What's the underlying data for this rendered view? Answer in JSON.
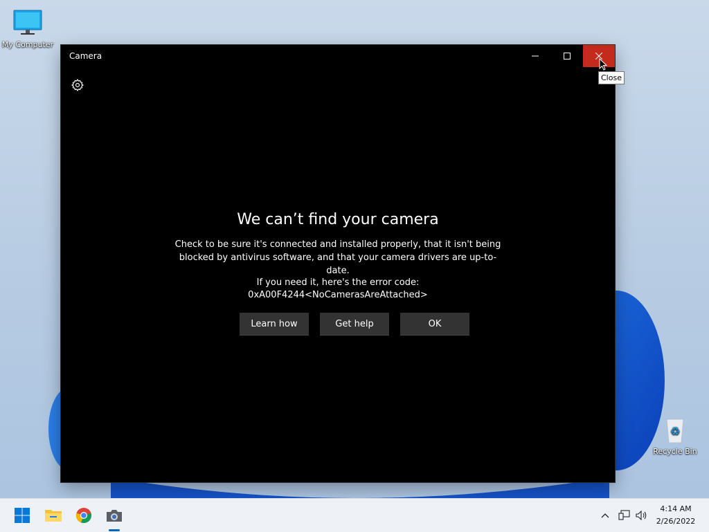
{
  "desktop": {
    "icons": [
      {
        "label": "My Computer",
        "icon": "monitor-icon"
      },
      {
        "label": "Recycle Bin",
        "icon": "recycle-bin-icon"
      }
    ]
  },
  "window": {
    "title": "Camera",
    "settings_icon": "gear-icon",
    "error": {
      "title": "We can’t find your camera",
      "description": "Check to be sure it's connected and installed properly, that it isn't being blocked by antivirus software, and that your camera drivers are up-to-date.",
      "code_label": "If you need it, here's the error code:",
      "code": "0xA00F4244<NoCamerasAreAttached>"
    },
    "buttons": {
      "learn_how": "Learn how",
      "get_help": "Get help",
      "ok": "OK"
    },
    "controls": [
      "minimize-icon",
      "maximize-icon",
      "close-icon"
    ]
  },
  "tooltip": {
    "text": "Close"
  },
  "taskbar": {
    "apps": [
      {
        "name": "Start",
        "icon": "windows-start-icon"
      },
      {
        "name": "File Explorer",
        "icon": "folder-icon"
      },
      {
        "name": "Google Chrome",
        "icon": "chrome-icon"
      },
      {
        "name": "Camera",
        "icon": "camera-icon",
        "active": true
      }
    ],
    "tray": [
      "chevron-up-icon",
      "network-icon",
      "speaker-icon"
    ],
    "time": "4:14 AM",
    "date": "2/26/2022"
  },
  "colors": {
    "close_hover": "#c42b1c",
    "button_bg": "#333333",
    "accent": "#0067c0"
  }
}
